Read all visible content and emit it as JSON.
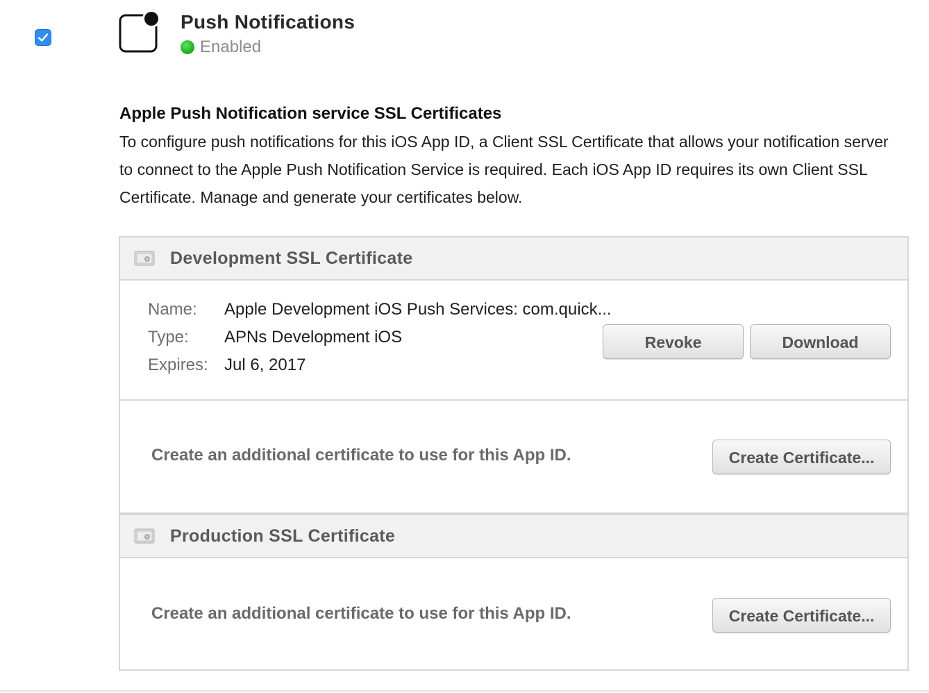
{
  "service": {
    "title": "Push Notifications",
    "status": "Enabled",
    "checked": true,
    "status_color": "#22b822",
    "accent_color": "#2f8df0"
  },
  "section": {
    "heading": "Apple Push Notification service SSL Certificates",
    "description": "To configure push notifications for this iOS App ID, a Client SSL Certificate that allows your notification server to connect to the Apple Push Notification Service is required. Each iOS App ID requires its own Client SSL Certificate. Manage and generate your certificates below."
  },
  "development": {
    "header": "Development SSL Certificate",
    "name_label": "Name:",
    "name_value": "Apple Development iOS Push Services: com.quick...",
    "type_label": "Type:",
    "type_value": "APNs Development iOS",
    "expires_label": "Expires:",
    "expires_value": "Jul 6, 2017",
    "revoke_label": "Revoke",
    "download_label": "Download",
    "create_text": "Create an additional certificate to use for this App ID.",
    "create_button": "Create Certificate..."
  },
  "production": {
    "header": "Production SSL Certificate",
    "create_text": "Create an additional certificate to use for this App ID.",
    "create_button": "Create Certificate..."
  },
  "icons": {
    "checkbox": "checkmark-icon",
    "service": "push-notification-icon",
    "certificate": "certificate-icon"
  }
}
